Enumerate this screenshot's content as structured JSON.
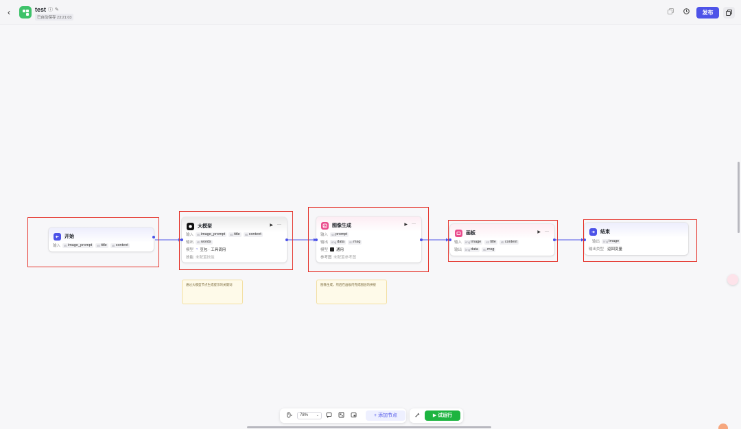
{
  "header": {
    "title": "test",
    "saved": "已自动保存 23:21:03",
    "publish_label": "发布"
  },
  "nodes": {
    "start": {
      "title": "开始",
      "input_label": "输入",
      "inputs": [
        "image_prompt",
        "title",
        "content"
      ]
    },
    "llm": {
      "title": "大模型",
      "input_label": "输入",
      "inputs": [
        "image_prompt",
        "title",
        "content"
      ],
      "output_label": "输出",
      "outputs": [
        "words"
      ],
      "model_label": "模型",
      "model": "豆包 · 工具调用",
      "skill_label": "技能",
      "skill": "未配置技能"
    },
    "image_gen": {
      "title": "图像生成",
      "input_label": "输入",
      "inputs": [
        "prompt"
      ],
      "output_label": "输出",
      "outputs": [
        "data",
        "msg"
      ],
      "model_label": "模型",
      "model": "通用",
      "ref_label": "参考图",
      "ref": "未配置参考图"
    },
    "canvas": {
      "title": "画板",
      "input_label": "输入",
      "inputs": [
        "image",
        "title",
        "content"
      ],
      "output_label": "输出",
      "outputs": [
        "data",
        "msg"
      ]
    },
    "end": {
      "title": "结束",
      "output_label": "输出",
      "outputs": [
        "image"
      ],
      "answer_label": "输出类型",
      "answer": "返回变量"
    }
  },
  "notes": {
    "note1": "通过大模型节点生成提示的关键词",
    "note2": "图像生成，然后在画板内完成图层的拼接"
  },
  "toolbar": {
    "zoom": "78%",
    "add_node_label": "添加节点",
    "run_label": "试运行"
  },
  "type_tags": {
    "str": "str",
    "img": "img"
  },
  "colors": {
    "accent": "#4d53e8",
    "start_icon": "#4d53e8",
    "llm_icon": "#111111",
    "image_icon": "#e94b8c",
    "canvas_icon": "#e94b8c",
    "end_icon": "#4d53e8",
    "highlight": "#e5352d",
    "run": "#1db440"
  }
}
